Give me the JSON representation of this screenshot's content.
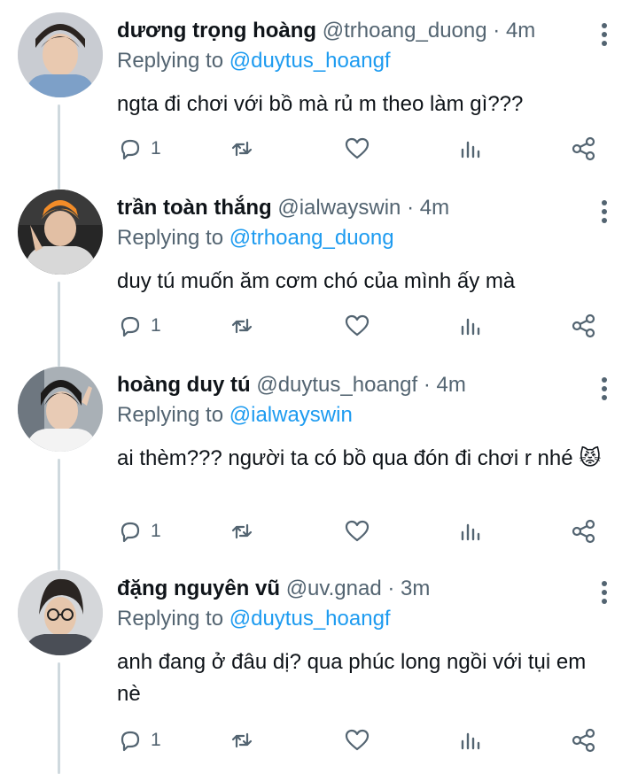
{
  "tweets": [
    {
      "name": "dương trọng hoàng",
      "handle": "@trhoang_duong",
      "time": "4m",
      "replying_prefix": "Replying to",
      "replying_to": "@duytus_hoangf",
      "text": "ngta đi chơi với bồ mà rủ m theo làm gì???",
      "reply_count": "1"
    },
    {
      "name": "trần toàn thắng",
      "handle": "@ialwayswin",
      "time": "4m",
      "replying_prefix": "Replying to",
      "replying_to": "@trhoang_duong",
      "text": "duy tú muốn ăm cơm chó của mình ấy mà",
      "reply_count": "1"
    },
    {
      "name": "hoàng duy tú",
      "handle": "@duytus_hoangf",
      "time": "4m",
      "replying_prefix": "Replying to",
      "replying_to": "@ialwayswin",
      "text": "ai thèm??? người ta có bồ qua đón đi chơi r nhé 😾",
      "reply_count": "1"
    },
    {
      "name": "đặng nguyên vũ",
      "handle": "@uv.gnad",
      "time": "3m",
      "replying_prefix": "Replying to",
      "replying_to": "@duytus_hoangf",
      "text": "anh đang ở đâu dị? qua phúc long ngồi với tụi em nè",
      "reply_count": "1"
    }
  ],
  "separator": "·",
  "colors": {
    "link": "#1d9bf0",
    "muted": "#536471",
    "text": "#0f1419",
    "thread": "#cfd9de"
  },
  "icons": [
    "reply-icon",
    "retweet-icon",
    "like-icon",
    "analytics-icon",
    "share-icon",
    "more-options-icon"
  ]
}
